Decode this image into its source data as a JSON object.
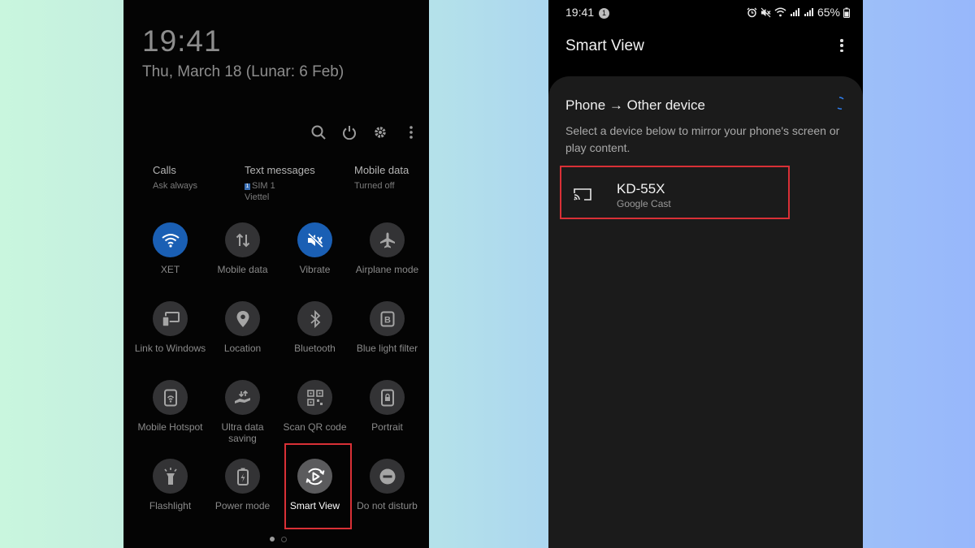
{
  "quick_panel": {
    "time": "19:41",
    "date": "Thu, March 18 (Lunar: 6 Feb)",
    "actions": [
      "search-icon",
      "power-icon",
      "gear-icon",
      "more-vert-icon"
    ],
    "info": {
      "calls": {
        "title": "Calls",
        "sub": "Ask always"
      },
      "text_messages": {
        "title": "Text messages",
        "sim_badge": "1",
        "sub": "SIM 1",
        "sub2": "Viettel"
      },
      "mobile_data": {
        "title": "Mobile data",
        "sub": "Turned off"
      }
    },
    "tiles": [
      {
        "label": "XET",
        "icon": "wifi-icon",
        "active": true
      },
      {
        "label": "Mobile data",
        "icon": "data-arrows-icon",
        "active": false
      },
      {
        "label": "Vibrate",
        "icon": "vibrate-icon",
        "active": true
      },
      {
        "label": "Airplane mode",
        "icon": "airplane-icon",
        "active": false
      },
      {
        "label": "Link to Windows",
        "icon": "link-to-windows-icon",
        "active": false
      },
      {
        "label": "Location",
        "icon": "location-pin-icon",
        "active": false
      },
      {
        "label": "Bluetooth",
        "icon": "bluetooth-icon",
        "active": false
      },
      {
        "label": "Blue light filter",
        "icon": "blue-light-filter-icon",
        "active": false
      },
      {
        "label": "Mobile Hotspot",
        "icon": "hotspot-icon",
        "active": false
      },
      {
        "label": "Ultra data saving",
        "icon": "data-saving-icon",
        "active": false
      },
      {
        "label": "Scan QR code",
        "icon": "qr-code-icon",
        "active": false
      },
      {
        "label": "Portrait",
        "icon": "portrait-lock-icon",
        "active": false
      },
      {
        "label": "Flashlight",
        "icon": "flashlight-icon",
        "active": false
      },
      {
        "label": "Power mode",
        "icon": "power-mode-icon",
        "active": false
      },
      {
        "label": "Smart View",
        "icon": "smart-view-icon",
        "active": false,
        "highlighted": true
      },
      {
        "label": "Do not disturb",
        "icon": "do-not-disturb-icon",
        "active": false
      }
    ],
    "page_indicator": {
      "pages": 2,
      "current": 1
    }
  },
  "smart_view": {
    "status_bar": {
      "time": "19:41",
      "notification_count": "1",
      "battery": "65%"
    },
    "title": "Smart View",
    "section_title": "Phone → Other device",
    "description": "Select a device below to mirror your phone's screen or play content.",
    "devices": [
      {
        "name": "KD-55X",
        "type": "Google Cast",
        "icon": "cast-screen-icon",
        "highlighted": true
      }
    ]
  },
  "colors": {
    "active_tile": "#1a5fb4",
    "highlight_border": "#d93036",
    "sheet_background": "#1b1b1b"
  }
}
